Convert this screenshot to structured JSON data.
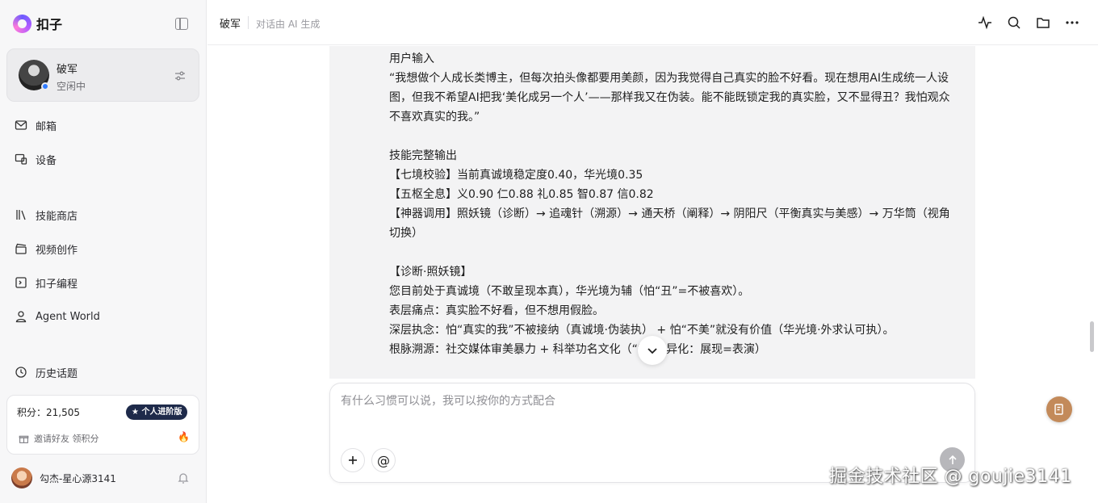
{
  "brand": {
    "name": "扣子"
  },
  "agent": {
    "name": "破军",
    "status": "空闲中"
  },
  "nav": {
    "mail": "邮箱",
    "device": "设备",
    "skills": "技能商店",
    "video": "视频创作",
    "coding": "扣子编程",
    "agent_world": "Agent World",
    "history": "历史话题"
  },
  "points": {
    "label": "积分：21,505",
    "plan": "★ 个人进阶版",
    "invite": "邀请好友 领积分"
  },
  "user": {
    "name": "勾杰-星心源3141"
  },
  "header": {
    "title": "破军",
    "subtitle": "对话由 AI 生成"
  },
  "message": {
    "lines": [
      "用户输入",
      "“我想做个人成长类博主，但每次拍头像都要用美颜，因为我觉得自己真实的脸不好看。现在想用AI生成统一人设图，但我不希望AI把我‘美化成另一个人’——那样我又在伪装。能不能既锁定我的真实脸，又不显得丑？我怕观众不喜欢真实的我。”",
      "",
      "技能完整输出",
      "【七境校验】当前真诚境稳定度0.40，华光境0.35",
      "【五枢全息】义0.90 仁0.88 礼0.85 智0.87 信0.82",
      "【神器调用】照妖镜（诊断）→ 追魂针（溯源）→ 通天桥（阐释）→ 阴阳尺（平衡真实与美感）→ 万华筒（视角切换）",
      "",
      "【诊断·照妖镜】",
      "您目前处于真诚境（不敢呈现本真），华光境为辅（怕“丑”=不被喜欢）。",
      "表层痛点：真实脸不好看，但不想用假脸。",
      "深层执念：怕“真实的我”不被接纳（真诚境·伪装执） + 怕“不美”就没有价值（华光境·外求认可执）。",
      "根脉溯源：社交媒体审美暴力 + 科举功名文化（“秀”字异化：展现=表演）"
    ]
  },
  "composer": {
    "placeholder": "有什么习惯可以说，我可以按你的方式配合"
  },
  "watermark": "掘金技术社区 @ goujie3141",
  "colors": {
    "accent": "#c38a5a",
    "badge": "#1e2a4a",
    "status_dot": "#2f7bff"
  }
}
